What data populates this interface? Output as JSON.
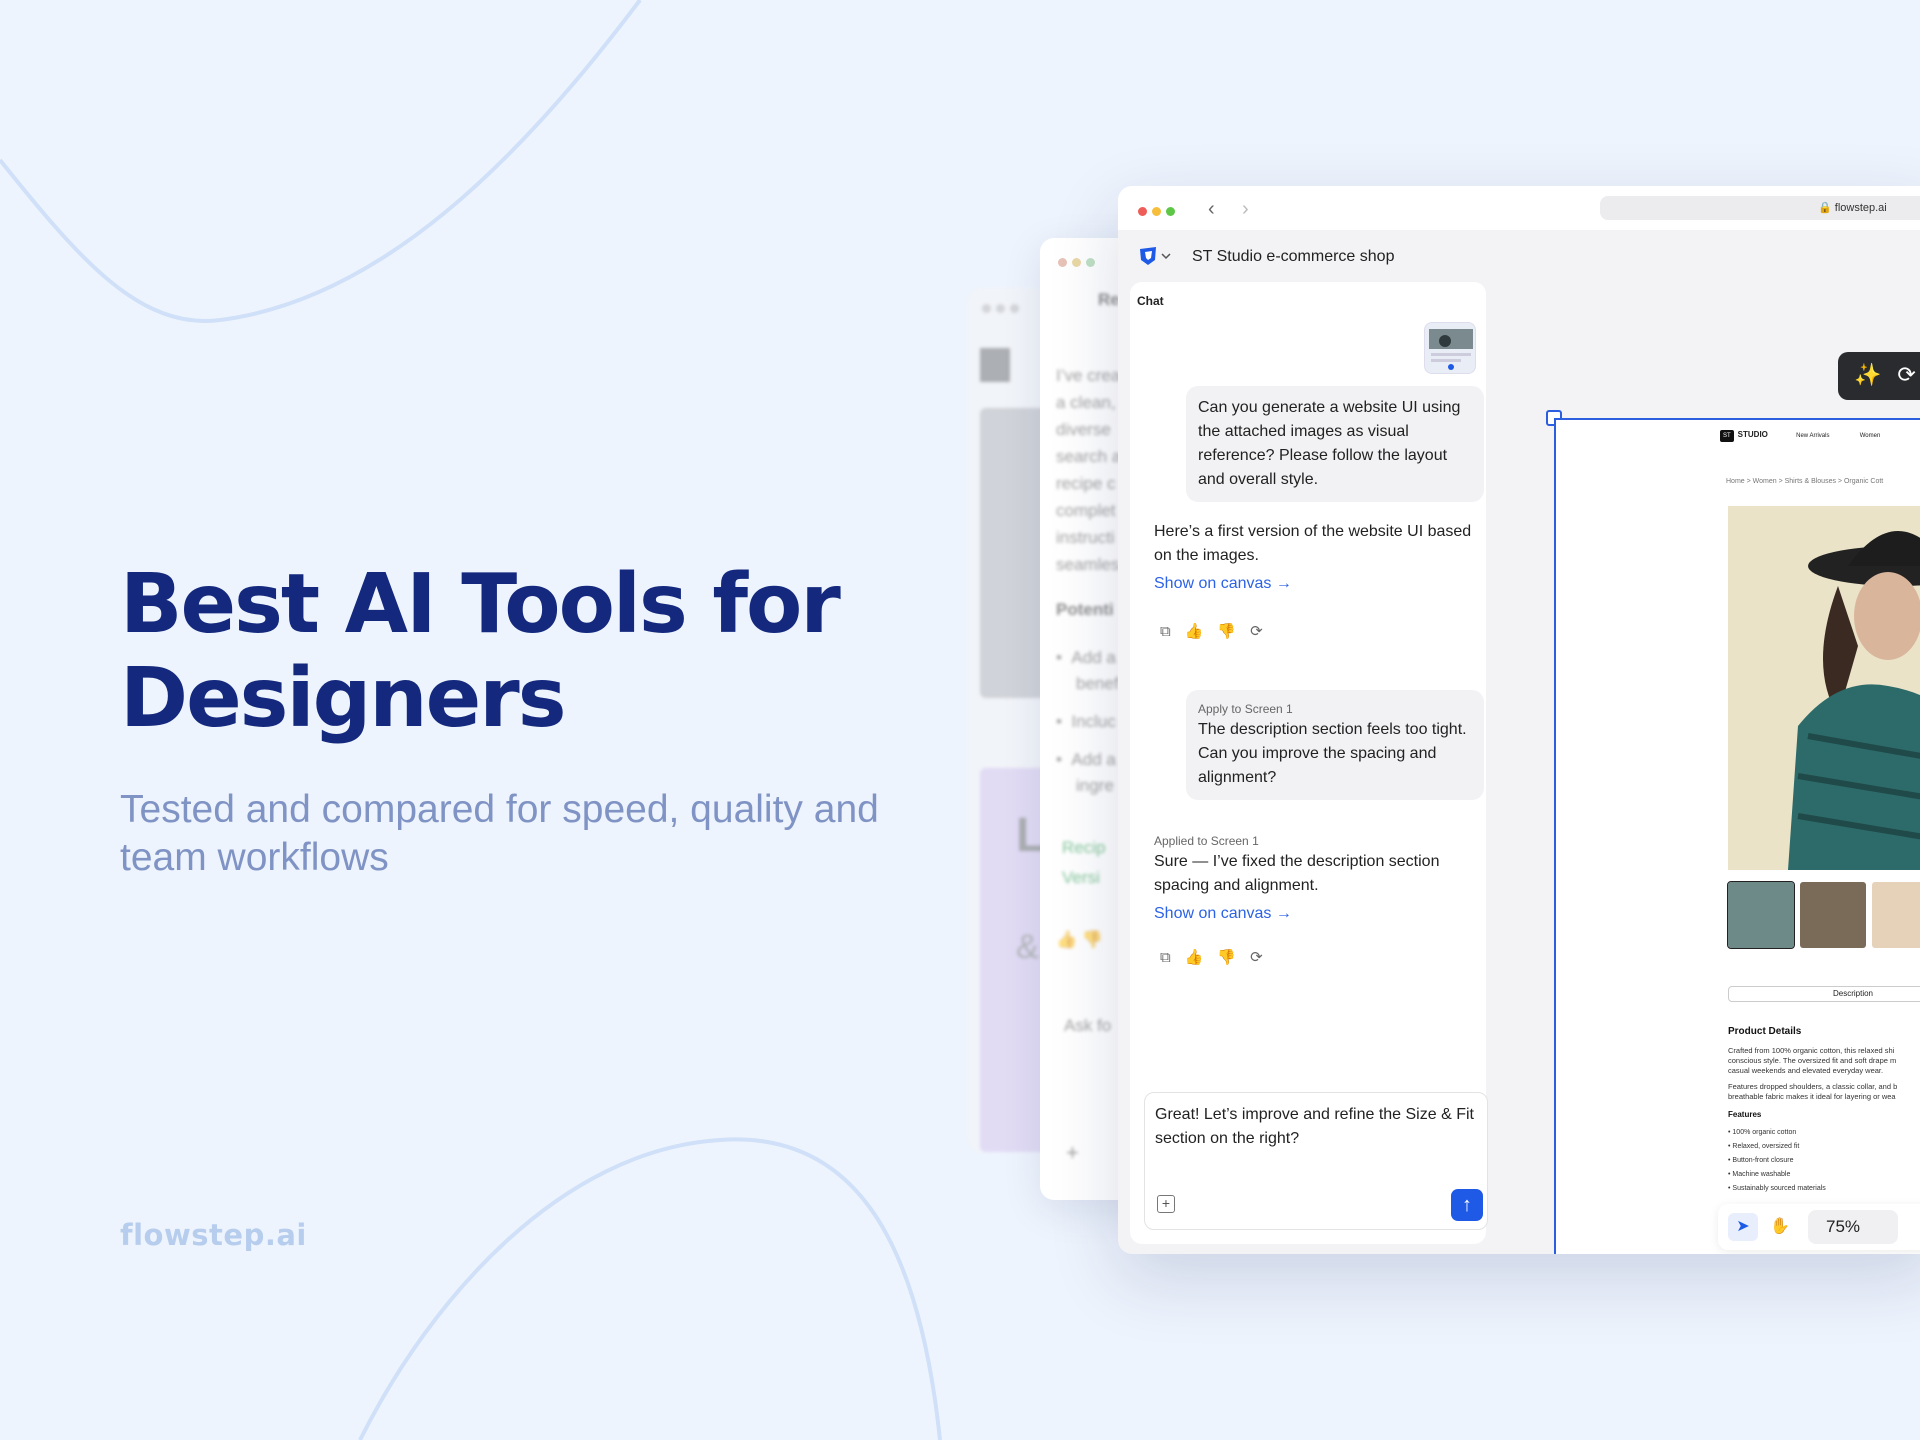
{
  "hero": {
    "title": "Best AI Tools for Designers",
    "subtitle": "Tested and compared for speed, quality and team workflows",
    "brand": "flowstep.ai"
  },
  "back_window": {
    "lines": [
      "I’ve crea",
      "a clean,",
      "diverse",
      "search a",
      "recipe c",
      "complet",
      "instructi",
      "seamles"
    ],
    "section_title": "Potenti",
    "bullets": [
      "Add a",
      "benef",
      "Incluc",
      "Add a",
      "ingre"
    ],
    "green_lines": [
      "Recip",
      "Versi"
    ],
    "input_placeholder": "Ask fo",
    "tab_label": "Re"
  },
  "browser": {
    "url": "flowstep.ai",
    "project_title": "ST Studio e-commerce shop"
  },
  "chat": {
    "label": "Chat",
    "messages": {
      "user1": "Can you generate a website UI using the attached images as visual reference? Please follow the layout and overall style.",
      "ai1": "Here’s a first version of the website UI based on the images.",
      "ai1_link": "Show on canvas →",
      "user2_meta": "Apply to Screen 1",
      "user2": "The description section feels too tight. Can you improve the spacing and alignment?",
      "ai2_meta": "Applied to Screen 1",
      "ai2": "Sure — I’ve fixed the description section spacing and alignment.",
      "ai2_link": "Show on canvas →"
    },
    "composer_text": "Great! Let’s improve and refine the Size & Fit section on the right?"
  },
  "canvas": {
    "site_brand": "STUDIO",
    "site_logo": "ST",
    "nav_items": [
      "New Arrivals",
      "Women"
    ],
    "breadcrumb": "Home  >  Women  >  Shirts & Blouses  >  Organic Cott",
    "description_tab": "Description",
    "product_details_title": "Product Details",
    "paragraph1": [
      "Crafted from 100% organic cotton, this relaxed shi",
      "conscious style. The oversized fit and soft drape m",
      "casual weekends and elevated everyday wear."
    ],
    "paragraph2": [
      "Features dropped shoulders, a classic collar, and b",
      "breathable fabric makes it ideal for layering or wea"
    ],
    "features_title": "Features",
    "features": [
      "100% organic cotton",
      "Relaxed, oversized fit",
      "Button-front closure",
      "Machine washable",
      "Sustainably sourced materials"
    ],
    "zoom": "75%"
  },
  "colors": {
    "background": "#eef4fd",
    "headline": "#14297d",
    "subtitle": "#7f93c4",
    "brand": "#b7cdee",
    "accent": "#1e5ae6",
    "link": "#2b62e6"
  }
}
